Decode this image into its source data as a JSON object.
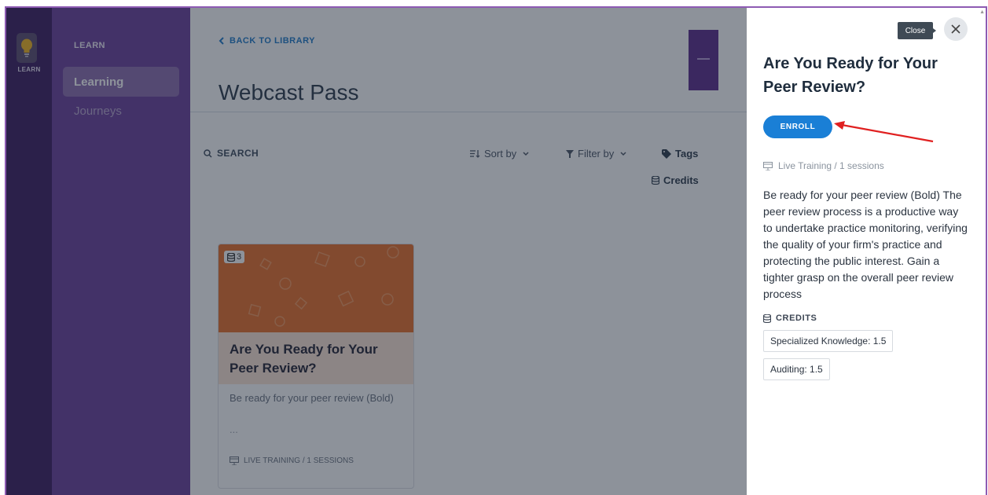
{
  "rail": {
    "label": "LEARN",
    "icon": "lightbulb-icon"
  },
  "subnav": {
    "heading": "LEARN",
    "items": [
      {
        "label": "Learning",
        "active": true
      },
      {
        "label": "Journeys",
        "active": false
      }
    ]
  },
  "main": {
    "back_label": "BACK TO LIBRARY",
    "title": "Webcast Pass",
    "search_label": "SEARCH",
    "sort_label": "Sort by",
    "filter_label": "Filter by",
    "tags_label": "Tags",
    "credits_label": "Credits",
    "card": {
      "badge_count": "3",
      "title": "Are You Ready for Your Peer Review?",
      "description": "Be ready for your peer review (Bold)",
      "ellipsis": "...",
      "meta": "LIVE TRAINING / 1 SESSIONS"
    }
  },
  "panel": {
    "close_tooltip": "Close",
    "title": "Are You Ready for Your Peer Review?",
    "enroll_label": "ENROLL",
    "session_meta": "Live Training / 1 sessions",
    "description": "Be ready for your peer review (Bold) The peer review process is a productive way to undertake practice monitoring, verifying the quality of your firm's practice and protecting the public interest. Gain a tighter grasp on the overall peer review process",
    "credits_heading": "CREDITS",
    "credits": [
      {
        "label": "Specialized Knowledge: 1.5"
      },
      {
        "label": "Auditing: 1.5"
      }
    ]
  },
  "colors": {
    "accent": "#1a7fd6",
    "rail": "#3b1a5e",
    "subnav": "#6a3f9a",
    "card_image": "#e86e28",
    "annotation_arrow": "#e02020"
  }
}
